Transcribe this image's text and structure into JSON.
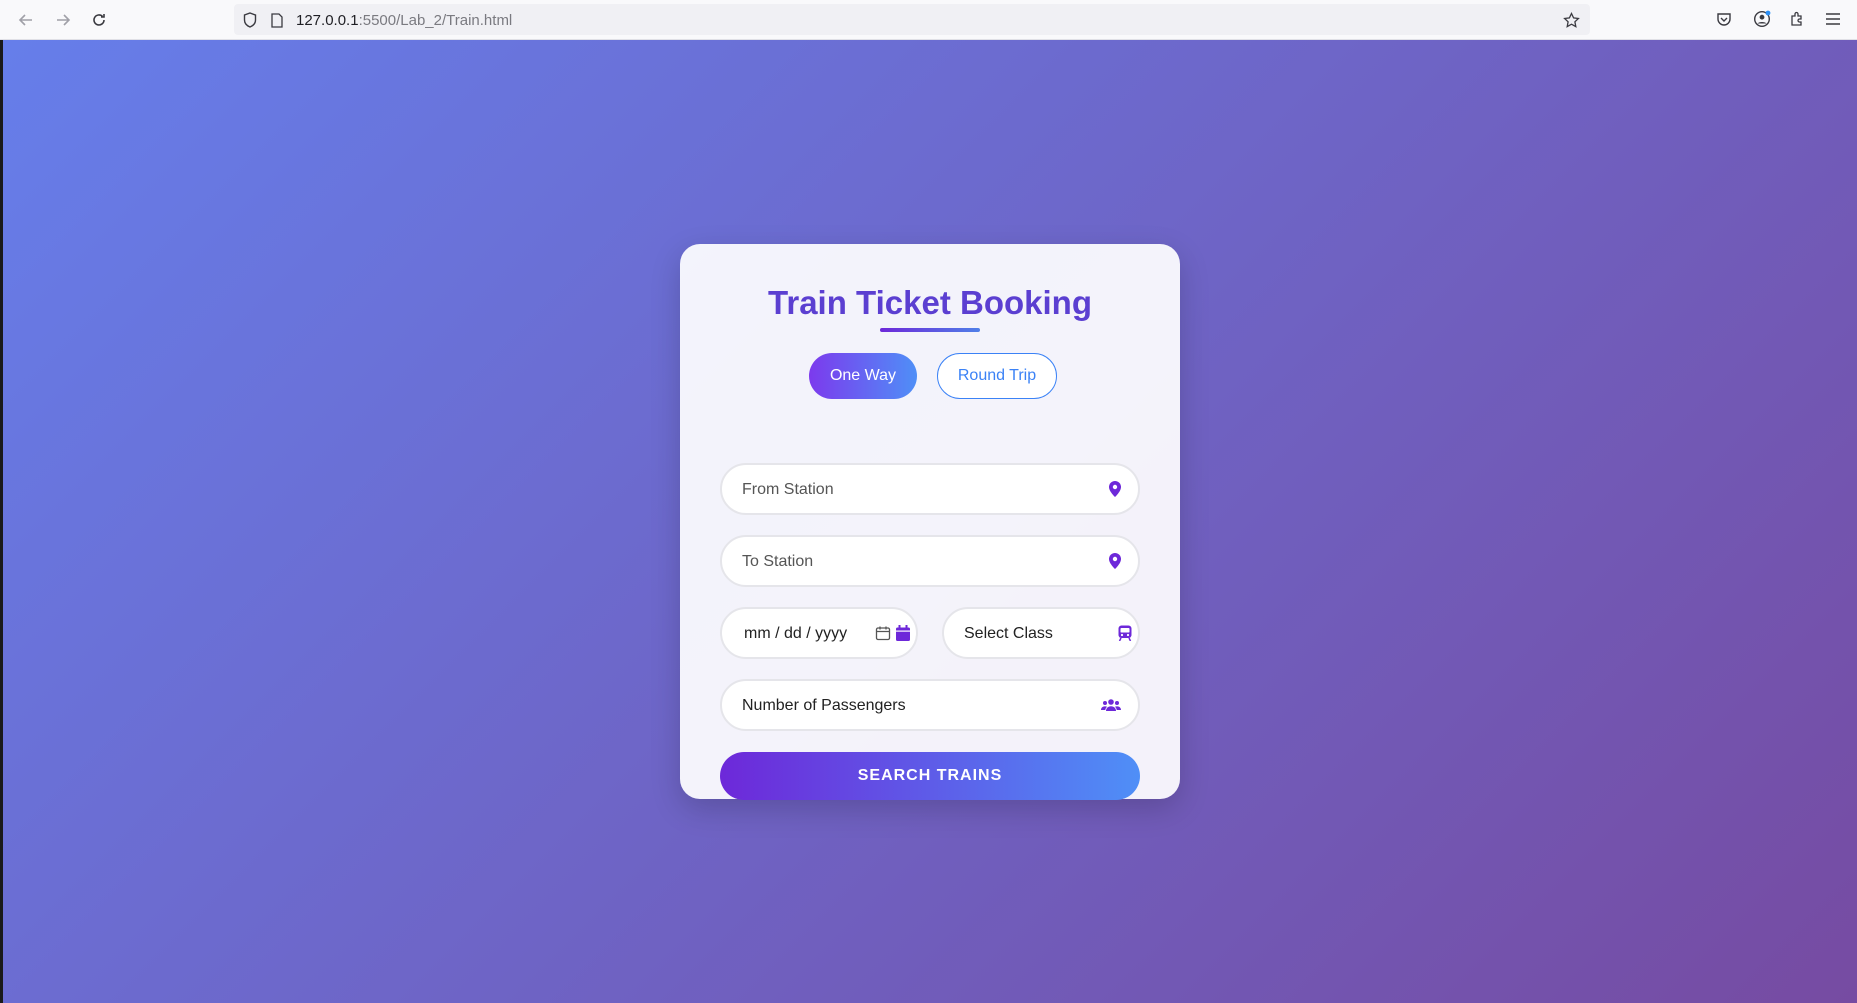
{
  "browser": {
    "url_host": "127.0.0.1",
    "url_rest": ":5500/Lab_2/Train.html",
    "icons": [
      "back-icon",
      "forward-icon",
      "reload-icon",
      "shield-icon",
      "page-icon",
      "bookmark-star-icon",
      "pocket-icon",
      "account-icon",
      "extensions-icon",
      "menu-icon"
    ]
  },
  "booking": {
    "title": "Train Ticket Booking",
    "trip_types": {
      "one_way": "One Way",
      "round_trip": "Round Trip",
      "selected": "One Way"
    },
    "fields": {
      "from_placeholder": "From Station",
      "to_placeholder": "To Station",
      "date_placeholder": "mm / dd / yyyy",
      "class_value": "Select Class",
      "passengers_value": "Number of Passengers"
    },
    "search_label": "SEARCH TRAINS"
  },
  "colors": {
    "gradient_start": "#667eea",
    "gradient_end": "#764ba2",
    "accent_purple": "#6d28d9",
    "accent_blue": "#4f8ff7",
    "title": "#5b3fd1"
  }
}
